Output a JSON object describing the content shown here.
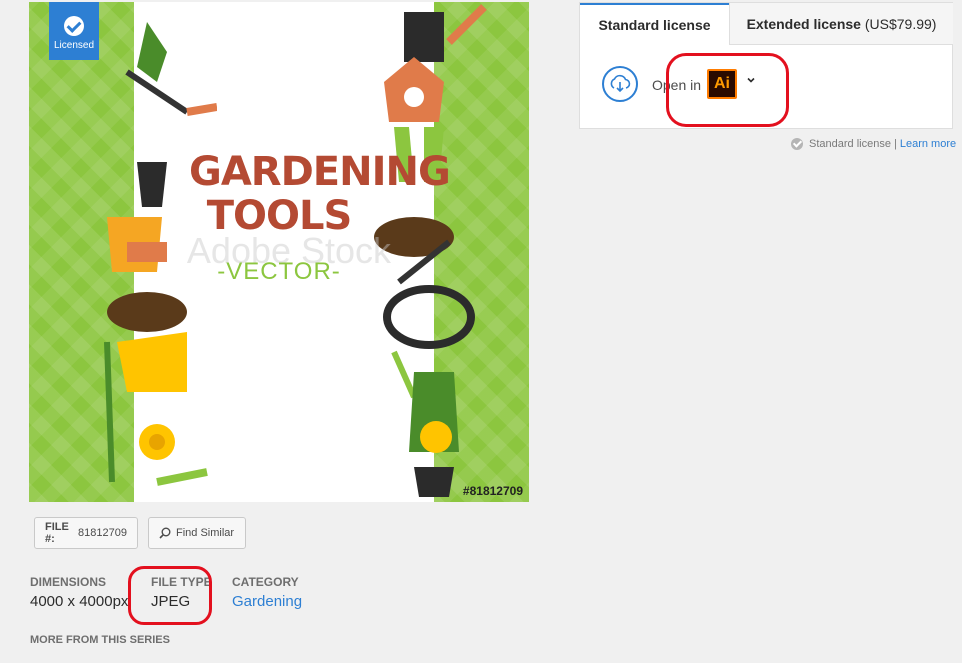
{
  "preview": {
    "licensed_badge": "Licensed",
    "title_line1": "GARDENING",
    "title_line2": "TOOLS",
    "subtitle": "-VECTOR-",
    "watermark": "Adobe Stock",
    "file_number_overlay": "#81812709"
  },
  "actions": {
    "file_label": "FILE #:",
    "file_value": "81812709",
    "find_similar": "Find Similar"
  },
  "meta": {
    "dimensions_label": "DIMENSIONS",
    "dimensions_value": "4000 x 4000px",
    "file_type_label": "FILE TYPE",
    "file_type_value": "JPEG",
    "category_label": "CATEGORY",
    "category_value": "Gardening",
    "more_series": "MORE FROM THIS SERIES"
  },
  "license": {
    "tab_standard": "Standard license",
    "tab_extended": "Extended license",
    "tab_extended_price": "(US$79.99)",
    "open_in": "Open in",
    "app_icon_text": "Ai",
    "note": "Standard license |",
    "learn_more": "Learn more"
  },
  "colors": {
    "accent": "#2d7fd3",
    "annotation": "#e3101e",
    "preview_green": "#8cc63f",
    "poster_title": "#b44a33"
  }
}
